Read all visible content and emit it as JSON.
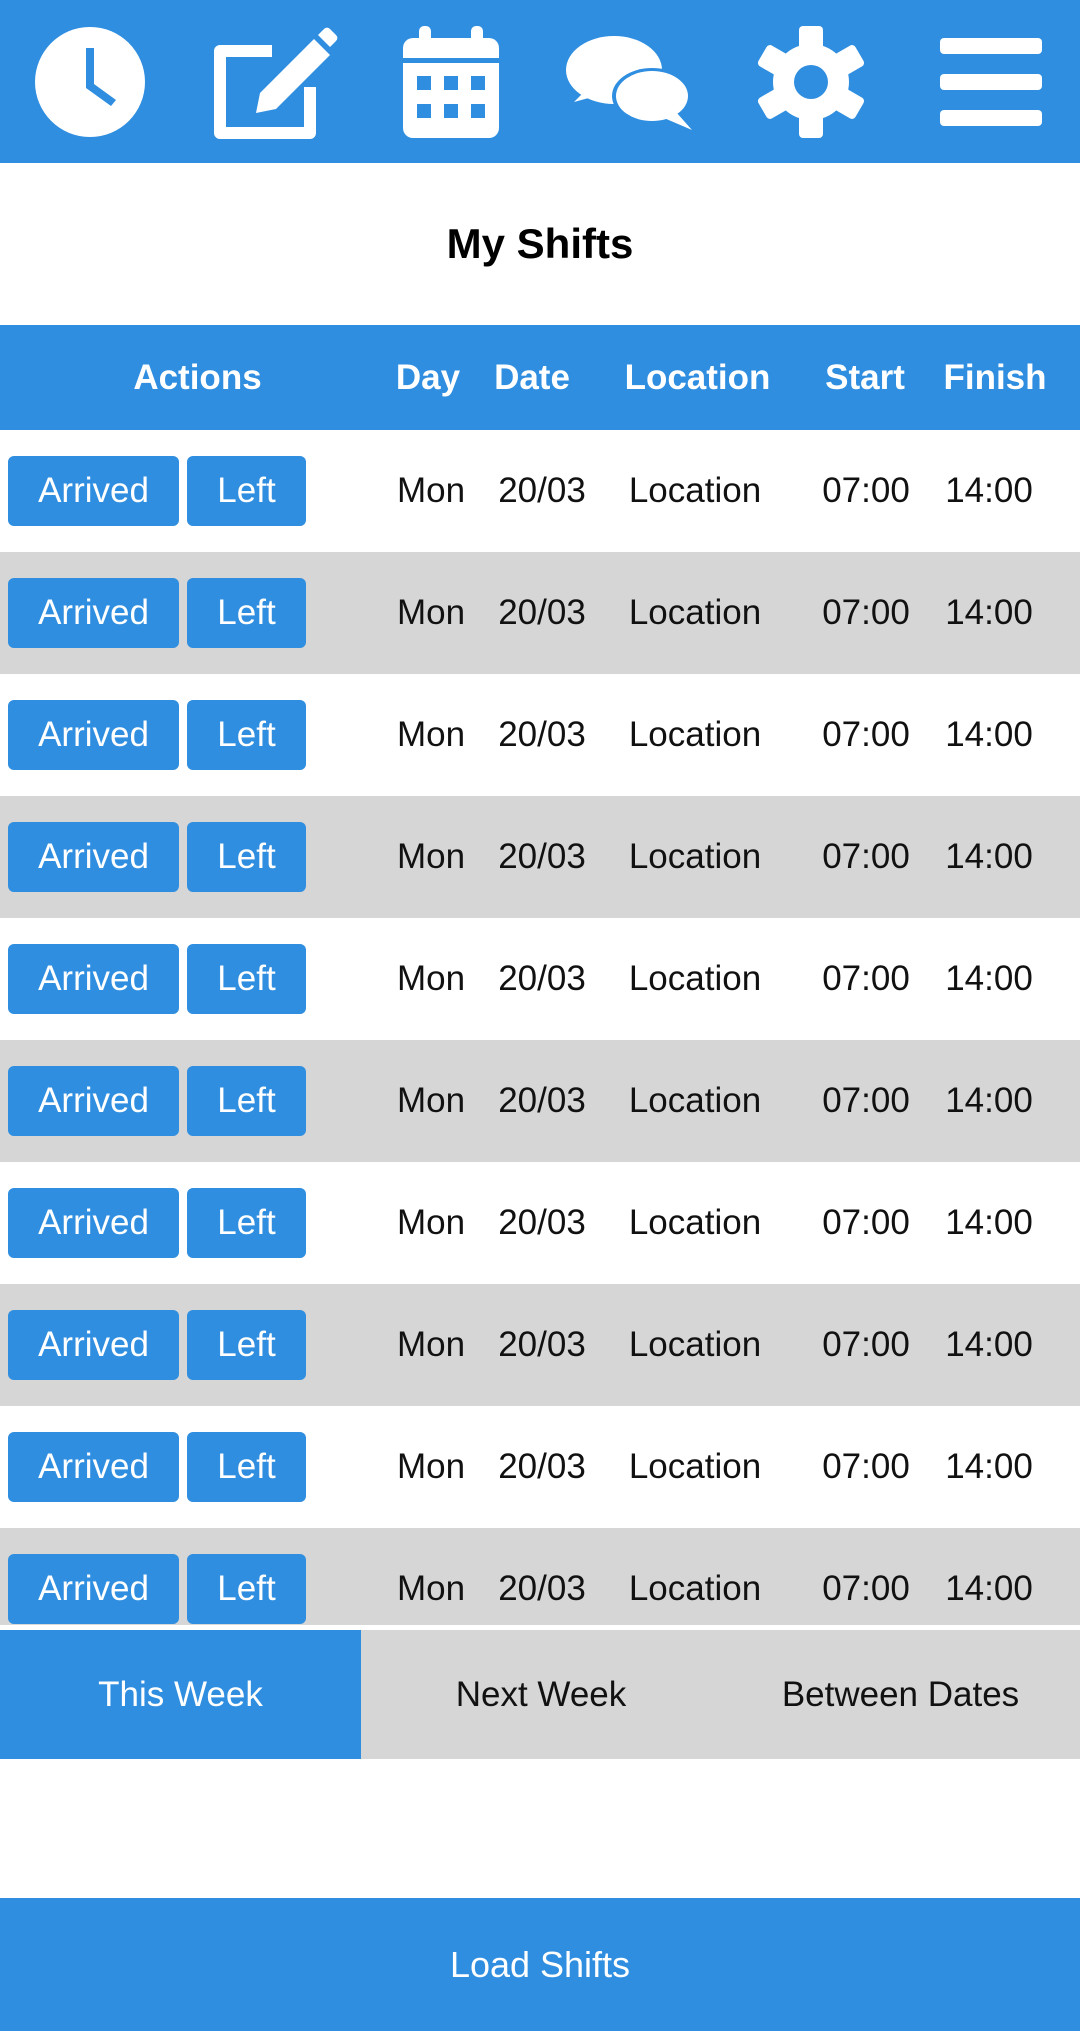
{
  "toolbar": {
    "icons": [
      "clock-icon",
      "edit-icon",
      "calendar-icon",
      "chat-icon",
      "gear-icon",
      "menu-icon"
    ]
  },
  "page": {
    "title": "My Shifts"
  },
  "table": {
    "headers": {
      "actions": "Actions",
      "day": "Day",
      "date": "Date",
      "location": "Location",
      "start": "Start",
      "finish": "Finish"
    },
    "rows": [
      {
        "arrived": "Arrived",
        "left": "Left",
        "day": "Mon",
        "date": "20/03",
        "location": "Location",
        "start": "07:00",
        "finish": "14:00"
      },
      {
        "arrived": "Arrived",
        "left": "Left",
        "day": "Mon",
        "date": "20/03",
        "location": "Location",
        "start": "07:00",
        "finish": "14:00"
      },
      {
        "arrived": "Arrived",
        "left": "Left",
        "day": "Mon",
        "date": "20/03",
        "location": "Location",
        "start": "07:00",
        "finish": "14:00"
      },
      {
        "arrived": "Arrived",
        "left": "Left",
        "day": "Mon",
        "date": "20/03",
        "location": "Location",
        "start": "07:00",
        "finish": "14:00"
      },
      {
        "arrived": "Arrived",
        "left": "Left",
        "day": "Mon",
        "date": "20/03",
        "location": "Location",
        "start": "07:00",
        "finish": "14:00"
      },
      {
        "arrived": "Arrived",
        "left": "Left",
        "day": "Mon",
        "date": "20/03",
        "location": "Location",
        "start": "07:00",
        "finish": "14:00"
      },
      {
        "arrived": "Arrived",
        "left": "Left",
        "day": "Mon",
        "date": "20/03",
        "location": "Location",
        "start": "07:00",
        "finish": "14:00"
      },
      {
        "arrived": "Arrived",
        "left": "Left",
        "day": "Mon",
        "date": "20/03",
        "location": "Location",
        "start": "07:00",
        "finish": "14:00"
      },
      {
        "arrived": "Arrived",
        "left": "Left",
        "day": "Mon",
        "date": "20/03",
        "location": "Location",
        "start": "07:00",
        "finish": "14:00"
      },
      {
        "arrived": "Arrived",
        "left": "Left",
        "day": "Mon",
        "date": "20/03",
        "location": "Location",
        "start": "07:00",
        "finish": "14:00"
      }
    ]
  },
  "tabs": [
    {
      "label": "This Week",
      "active": true
    },
    {
      "label": "Next Week",
      "active": false
    },
    {
      "label": "Between Dates",
      "active": false
    }
  ],
  "footer": {
    "load_label": "Load Shifts"
  },
  "colors": {
    "accent": "#2f8ee0",
    "row_alt": "#d6d6d6",
    "white": "#ffffff"
  }
}
